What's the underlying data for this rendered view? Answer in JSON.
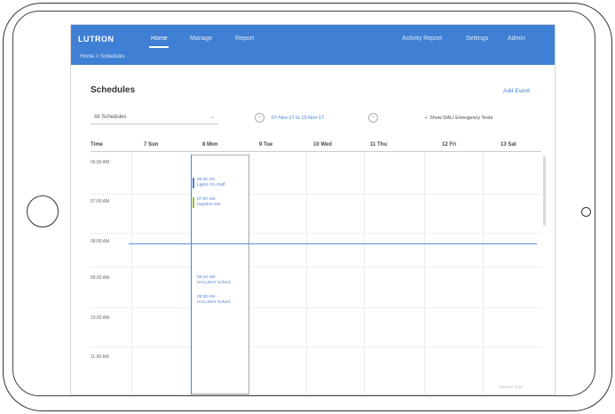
{
  "app": {
    "logo": "LUTRON",
    "nav": [
      "Home",
      "Manage",
      "Report"
    ],
    "nav_right": [
      "Activity Report",
      "Settings",
      "Admin"
    ],
    "breadcrumb": "Home > Schedules"
  },
  "page": {
    "title": "Schedules",
    "add_event_label": "Add Event"
  },
  "filters": {
    "schedule_select": "All Schedules",
    "date_range": "07-Nov-17 to 13-Nov-17",
    "dali_checkbox": "Show DALI Emergency Tests"
  },
  "calendar": {
    "time_header": "Time",
    "days": [
      "7 Sun",
      "8 Mon",
      "9 Tue",
      "10 Wed",
      "11 Thu",
      "12 Fri",
      "13 Sat"
    ],
    "hours": [
      "06:00 AM",
      "07:00 AM",
      "08:00 AM",
      "09:00 AM",
      "10:00 AM",
      "11:00 AM"
    ],
    "events": [
      {
        "time": "06:30 AM",
        "title": "Lights On Staff",
        "color": "blue"
      },
      {
        "time": "07:00 AM",
        "title": "Daytime ON",
        "color": "green"
      },
      {
        "time": "09:15 AM",
        "title": "HALLWAY Sched...",
        "color": "blue"
      },
      {
        "time": "09:30 AM",
        "title": "HALLWAY Sched...",
        "color": "blue"
      }
    ]
  },
  "footer": "Myroom Plus",
  "colors": {
    "accent": "#3f7fd4",
    "event_green": "#8fbf3f"
  }
}
